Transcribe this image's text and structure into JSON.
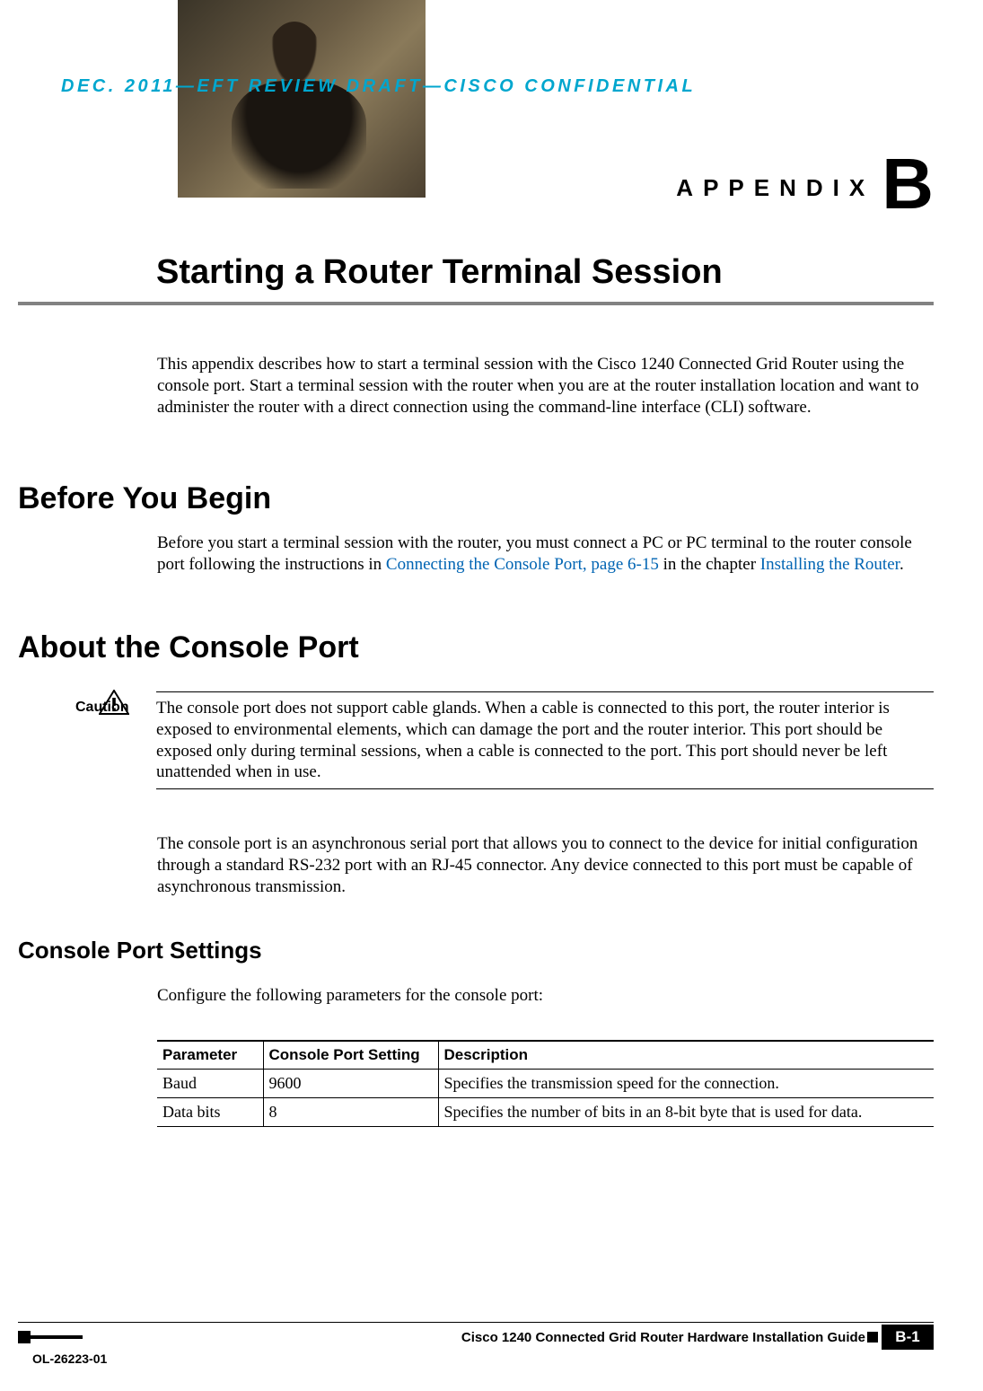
{
  "confidential_banner": "DEC. 2011—EFT REVIEW DRAFT—CISCO CONFIDENTIAL",
  "appendix": {
    "label": "APPENDIX",
    "letter": "B"
  },
  "title": "Starting a Router Terminal Session",
  "intro": "This appendix describes how to start a terminal session with the Cisco 1240 Connected Grid Router using the console port. Start a terminal session with the router when you are at the router installation location and want to administer the router with a direct connection using the command-line interface (CLI) software.",
  "sections": {
    "before": {
      "heading": "Before You Begin",
      "body_pre": "Before you start a terminal session with the router, you must connect a PC or PC terminal to the router console port following the instructions in ",
      "link1": "Connecting the Console Port, page 6-15",
      "body_mid": " in the chapter ",
      "link2": "Installing the Router",
      "body_post": "."
    },
    "about": {
      "heading": "About the Console Port",
      "caution_label": "Caution",
      "caution_text": "The console port does not support cable glands. When a cable is connected to this port, the router interior is exposed to environmental elements, which can damage the port and the router interior. This port should be exposed only during terminal sessions, when a cable is connected to the port. This port should never be left unattended when in use.",
      "body": "The console port is an asynchronous serial port that allows you to connect to the device for initial configuration through a standard RS-232 port with an RJ-45 connector. Any device connected to this port must be capable of asynchronous transmission."
    },
    "settings": {
      "heading": "Console Port Settings",
      "body": "Configure the following parameters for the console port:",
      "table": {
        "headers": {
          "c0": "Parameter",
          "c1": "Console Port Setting",
          "c2": "Description"
        },
        "rows": [
          {
            "c0": "Baud",
            "c1": "9600",
            "c2": "Specifies the transmission speed for the connection."
          },
          {
            "c0": "Data bits",
            "c1": "8",
            "c2": "Specifies the number of bits in an 8-bit byte that is used for data."
          }
        ]
      }
    }
  },
  "footer": {
    "doc_title": "Cisco 1240 Connected Grid Router Hardware Installation Guide",
    "page": "B-1",
    "ol": "OL-26223-01"
  }
}
